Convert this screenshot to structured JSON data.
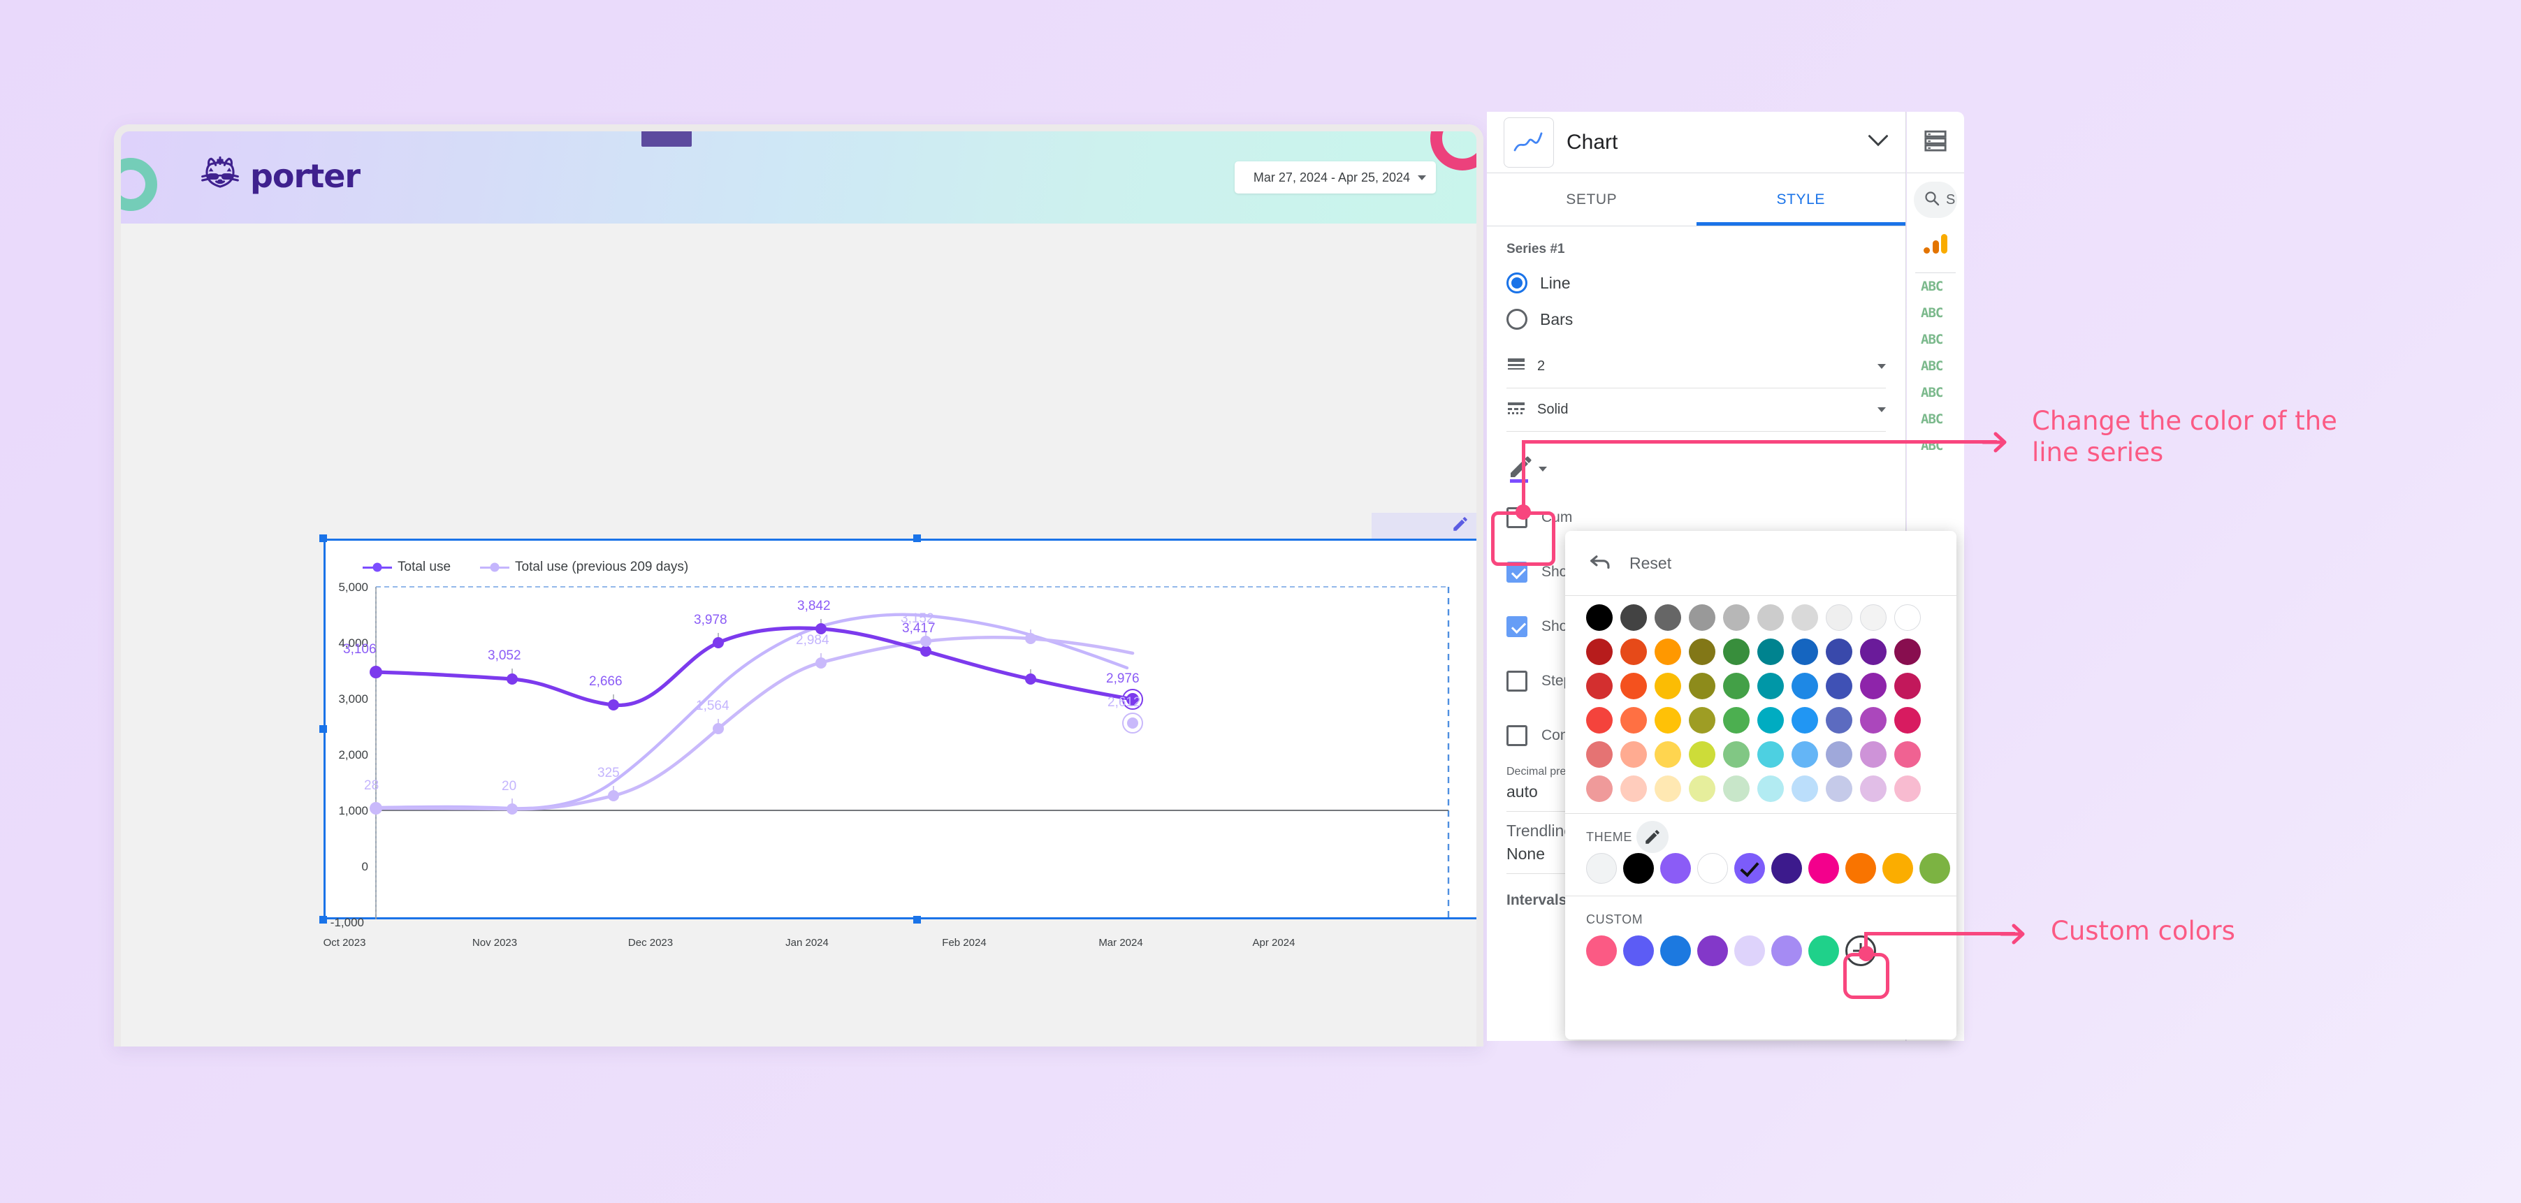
{
  "window": {
    "brand_name": "porter",
    "date_range": "Mar 27, 2024 - Apr 25, 2024"
  },
  "chart_data": {
    "type": "line",
    "title": "",
    "xlabel": "",
    "ylabel": "",
    "ylim": [
      -1000,
      5000
    ],
    "ytick_labels": [
      "5,000",
      "4,000",
      "3,000",
      "2,000",
      "1,000",
      "0",
      "-1,000"
    ],
    "categories": [
      "Oct 2023",
      "Nov 2023",
      "Dec 2023",
      "Jan 2024",
      "Feb 2024",
      "Mar 2024",
      "Apr 2024"
    ],
    "grid": true,
    "legend_position": "top-left",
    "series": [
      {
        "name": "Total use",
        "color": "#7c4dff",
        "values": [
          3106,
          3052,
          2666,
          3978,
          3842,
          3417,
          2976
        ],
        "labels": [
          "3,106",
          "3,052",
          "2,666",
          "3,978",
          "3,842",
          "3,417",
          "2,976"
        ]
      },
      {
        "name": "Total use (previous 209 days)",
        "color": "#c4b5fd",
        "values": [
          28,
          20,
          325,
          1564,
          2984,
          3152,
          2612
        ],
        "labels": [
          "28",
          "20",
          "325",
          "1,564",
          "2,984",
          "3,152",
          "2,612"
        ]
      }
    ]
  },
  "properties_panel": {
    "title": "Chart",
    "tabs": [
      {
        "label": "SETUP",
        "active": false
      },
      {
        "label": "STYLE",
        "active": true
      }
    ],
    "series_label": "Series #1",
    "chart_type_options": [
      {
        "label": "Line",
        "selected": true
      },
      {
        "label": "Bars",
        "selected": false
      }
    ],
    "line_weight": {
      "label": "2",
      "icon": "line-weight-icon"
    },
    "line_style": {
      "label": "Solid",
      "icon": "line-style-icon"
    },
    "checkboxes": [
      {
        "label": "Cum",
        "checked": false
      },
      {
        "label": "Show",
        "checked": true
      },
      {
        "label": "Show",
        "checked": true
      },
      {
        "label": "Step",
        "checked": false
      },
      {
        "label": "Com",
        "checked": false
      }
    ],
    "decimal_precision": {
      "label": "Decimal preci",
      "value": "auto"
    },
    "trendline": {
      "label": "Trendline",
      "value": "None"
    },
    "intervals_label": "Intervals"
  },
  "color_picker": {
    "reset_label": "Reset",
    "theme_label": "THEME",
    "custom_label": "CUSTOM",
    "selected_swatch_index": 4,
    "grid": [
      [
        "#000000",
        "#434343",
        "#666666",
        "#999999",
        "#b7b7b7",
        "#cccccc",
        "#d9d9d9",
        "#efefef",
        "#f3f3f3",
        "#ffffff"
      ],
      [
        "#b71c1c",
        "#e64a19",
        "#ff9800",
        "#827717",
        "#388e3c",
        "#00838f",
        "#1565c0",
        "#3949ab",
        "#6a1b9a",
        "#880e4f"
      ],
      [
        "#d32f2f",
        "#f4511e",
        "#fbbc04",
        "#8d8b1b",
        "#43a047",
        "#0097a7",
        "#1e88e5",
        "#3f51b5",
        "#8e24aa",
        "#c2185b"
      ],
      [
        "#f4433c",
        "#ff7043",
        "#ffc107",
        "#9e9d24",
        "#4caf50",
        "#00acc1",
        "#2196f3",
        "#5c6bc0",
        "#ab47bc",
        "#d81b60"
      ],
      [
        "#e57373",
        "#ffab91",
        "#ffd54f",
        "#cddc39",
        "#81c784",
        "#4dd0e1",
        "#64b5f6",
        "#9fa8da",
        "#ce93d8",
        "#f06292"
      ],
      [
        "#ef9a9a",
        "#ffccbc",
        "#ffe8b2",
        "#e6ee9c",
        "#c8e6c9",
        "#b2ebf2",
        "#bbdefb",
        "#c5cae9",
        "#e1bee7",
        "#f8bbd0"
      ]
    ],
    "theme_swatches": [
      "#f1f3f4",
      "#000000",
      "#8b5cf6",
      "#ffffff",
      "#7c5cfa",
      "#3c1a8c",
      "#f3008c",
      "#f97400",
      "#fbad00",
      "#7cb342"
    ],
    "custom_swatches": [
      "#fb5a84",
      "#5c5cf5",
      "#1c79e0",
      "#8338c9",
      "#ded3fb",
      "#a58bf3",
      "#1fd18a"
    ]
  },
  "data_panel": {
    "search_placeholder": "S",
    "source_icon": "google-analytics-icon",
    "fields": [
      "ABC",
      "ABC",
      "ABC",
      "ABC",
      "ABC",
      "ABC",
      "ABC"
    ]
  },
  "annotations": [
    {
      "id": "annotation-line-color",
      "text_line1": "Change the color of the",
      "text_line2": "line series"
    },
    {
      "id": "annotation-custom-colors",
      "text_line1": "Custom colors",
      "text_line2": ""
    }
  ]
}
